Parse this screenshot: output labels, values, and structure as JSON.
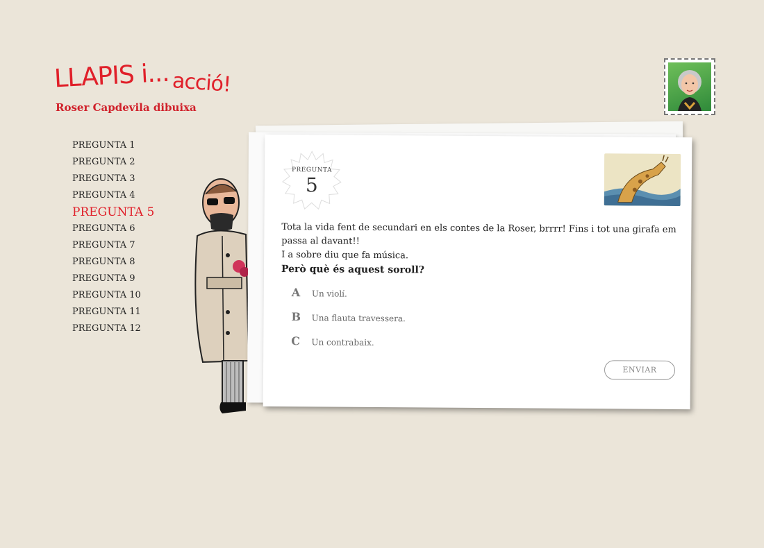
{
  "header": {
    "logo_line1": "LLAPIS i...",
    "logo_line2": "acció!",
    "subtitle": "Roser Capdevila dibuixa"
  },
  "nav": {
    "items": [
      {
        "label": "PREGUNTA 1"
      },
      {
        "label": "PREGUNTA 2"
      },
      {
        "label": "PREGUNTA 3"
      },
      {
        "label": "PREGUNTA 4"
      },
      {
        "label": "PREGUNTA 5",
        "active": true
      },
      {
        "label": "PREGUNTA 6"
      },
      {
        "label": "PREGUNTA 7"
      },
      {
        "label": "PREGUNTA 8"
      },
      {
        "label": "PREGUNTA 9"
      },
      {
        "label": "PREGUNTA 10"
      },
      {
        "label": "PREGUNTA 11"
      },
      {
        "label": "PREGUNTA 12"
      }
    ]
  },
  "card": {
    "badge_label": "PREGUNTA",
    "badge_number": "5",
    "question_line1": "Tota la vida fent de secundari en els contes de la Roser, brrrr! Fins i tot una girafa em passa al davant!!",
    "question_line2": "I a sobre diu que fa música.",
    "question_ask": "Però què és aquest soroll?",
    "options": [
      {
        "letter": "A",
        "text": "Un violí."
      },
      {
        "letter": "B",
        "text": "Una flauta travessera."
      },
      {
        "letter": "C",
        "text": "Un contrabaix."
      }
    ],
    "send_label": "ENVIAR"
  },
  "colors": {
    "background": "#ebe5d9",
    "accent": "#e0202a"
  },
  "icons": {
    "avatar": "illustrated-portrait-icon",
    "thumbnail": "giraffe-illustration",
    "character": "man-character-illustration"
  }
}
